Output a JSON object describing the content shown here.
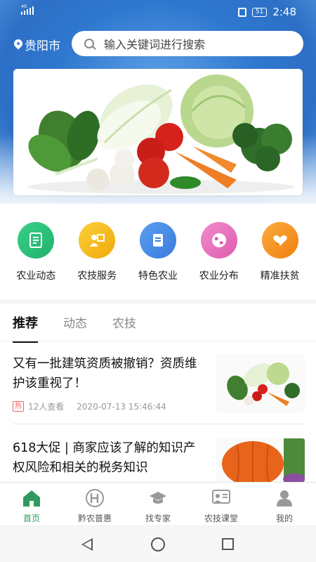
{
  "status_bar": {
    "network": "4G",
    "battery": "51",
    "time": "2:48"
  },
  "header": {
    "location": "贵阳市",
    "search_placeholder": "输入关键词进行搜索"
  },
  "banner": {
    "image": "vegetables-banner"
  },
  "menu": [
    {
      "label": "农业动态",
      "icon": "document-icon",
      "color": "#2fc47d"
    },
    {
      "label": "农技服务",
      "icon": "person-board-icon",
      "color": "#f5b50f"
    },
    {
      "label": "特色农业",
      "icon": "notepad-icon",
      "color": "#4a8fe6"
    },
    {
      "label": "农业分布",
      "icon": "globe-icon",
      "color": "#e86fbd"
    },
    {
      "label": "精准扶贫",
      "icon": "heart-hand-icon",
      "color": "#f7941d"
    }
  ],
  "feed": {
    "tabs": [
      "推荐",
      "动态",
      "农技"
    ],
    "active_tab": "推荐",
    "articles": [
      {
        "title": "又有一批建筑资质被撤销？资质维护该重视了！",
        "badge": "热",
        "views": "12人查看",
        "date": "2020-07-13 15:46:44",
        "thumb": "vegetables-thumbnail"
      },
      {
        "title": "618大促 | 商家应该了解的知识产权风险和相关的税务知识",
        "thumb": "pumpkin-thumbnail"
      }
    ]
  },
  "tabbar": [
    {
      "label": "首页",
      "icon": "home-icon",
      "active": true
    },
    {
      "label": "黔农普惠",
      "icon": "qiannong-logo-icon",
      "active": false
    },
    {
      "label": "找专家",
      "icon": "graduation-cap-icon",
      "active": false
    },
    {
      "label": "农技课堂",
      "icon": "classroom-icon",
      "active": false
    },
    {
      "label": "我的",
      "icon": "user-icon",
      "active": false
    }
  ],
  "colors": {
    "accent": "#2f9a5d",
    "header_blue": "#2f78cf"
  }
}
